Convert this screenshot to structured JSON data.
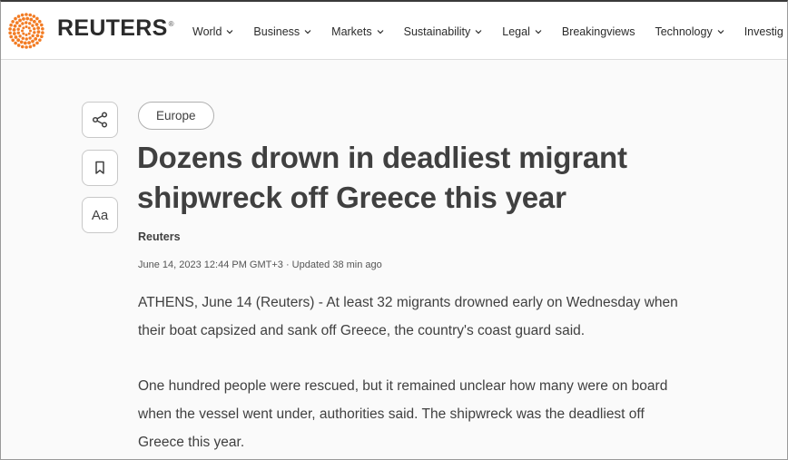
{
  "header": {
    "logo_text": "REUTERS",
    "logo_reg": "®",
    "nav": [
      {
        "label": "World",
        "dropdown": true
      },
      {
        "label": "Business",
        "dropdown": true
      },
      {
        "label": "Markets",
        "dropdown": true
      },
      {
        "label": "Sustainability",
        "dropdown": true
      },
      {
        "label": "Legal",
        "dropdown": true
      },
      {
        "label": "Breakingviews",
        "dropdown": false
      },
      {
        "label": "Technology",
        "dropdown": true
      },
      {
        "label": "Investig",
        "dropdown": false
      }
    ]
  },
  "rail": {
    "share_icon": "share-icon",
    "bookmark_icon": "bookmark-icon",
    "text_size_label": "Aa"
  },
  "article": {
    "section_tag": "Europe",
    "headline_line1": "Dozens drown in deadliest migrant",
    "headline_line2": "shipwreck off Greece this year",
    "byline": "Reuters",
    "dateline": "June 14, 2023 12:44 PM GMT+3 · Updated 38 min ago",
    "paragraphs": [
      {
        "line1": "ATHENS, June 14 (Reuters) - At least 32 migrants drowned early on Wednesday when",
        "line2": "their boat capsized and sank off Greece, the country's coast guard said."
      },
      {
        "line1": "One hundred people were rescued, but it remained unclear how many were on board",
        "line2": "when the vessel went under, authorities said. The shipwreck was the deadliest off",
        "line3": "Greece this year."
      }
    ]
  },
  "colors": {
    "brand_orange": "#f27c24",
    "text": "#404040",
    "background": "#fafafa"
  }
}
